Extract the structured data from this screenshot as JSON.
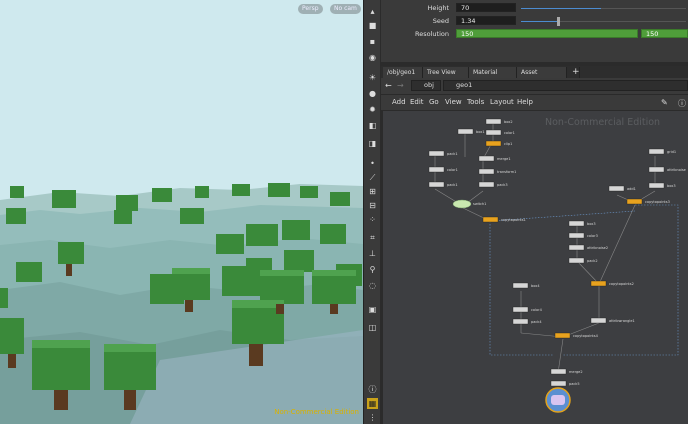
{
  "viewport": {
    "persp_label": "Persp",
    "cam_label": "No cam",
    "watermark": "Non-Commercial Edition",
    "colors": {
      "sky": "#cfe9ee",
      "grass": "#8fb8b8",
      "tree": "#3b8a3b",
      "trunk": "#5a3a20"
    }
  },
  "params": {
    "height_label": "Height",
    "height_value": "70",
    "seed_label": "Seed",
    "seed_value": "1.34",
    "resolution_label": "Resolution",
    "resolution_value_1": "150",
    "resolution_value_2": "150"
  },
  "tabs": [
    "/obj/geo1",
    "Tree View",
    "Material Palette",
    "Asset Browser"
  ],
  "path": {
    "obj": "obj",
    "geo": "geo1"
  },
  "menu": [
    "Add",
    "Edit",
    "Go",
    "View",
    "Tools",
    "Layout",
    "Help"
  ],
  "network": {
    "watermark": "Non-Commercial Edition",
    "nodes": {
      "box2": "box2",
      "color1": "color1",
      "clip1": "clip1",
      "box1": "box1",
      "merge1": "merge1",
      "pack1": "pack1",
      "transform1": "transform1",
      "pack3": "pack3",
      "switch1": "switch1",
      "copytopoints1": "copytopoints1",
      "add1": "add1",
      "copytopoints3": "copytopoints3",
      "grid1": "grid1",
      "attribnoise": "attribnoise",
      "box3": "box3",
      "color3": "color3",
      "pack2": "pack2",
      "copytopoints2": "copytopoints2",
      "box4": "box4",
      "color4": "color4",
      "pack4": "pack4",
      "copytopoints4": "copytopoints4",
      "merge2": "merge2",
      "pack5": "pack5",
      "attribnoise2": "attribnoise2",
      "attribwrangle1": "attribwrangle1"
    }
  }
}
